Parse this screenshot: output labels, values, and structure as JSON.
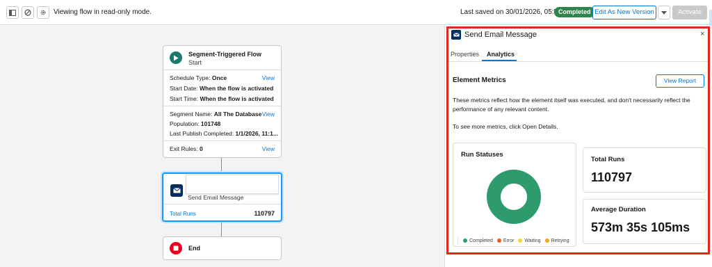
{
  "toolbar": {
    "read_only_message": "Viewing flow in read-only mode.",
    "last_saved": "Last saved on 30/01/2026, 05:54 am",
    "status_badge": "Completed",
    "edit_button": "Edit As New Version",
    "activate_button": "Activate"
  },
  "start_node": {
    "title": "Segment-Triggered Flow",
    "subtitle": "Start",
    "schedule_type_label": "Schedule Type:",
    "schedule_type_value": "Once",
    "start_date_label": "Start Date:",
    "start_date_value": "When the flow is activated",
    "start_time_label": "Start Time:",
    "start_time_value": "When the flow is activated",
    "segment_name_label": "Segment Name:",
    "segment_name_value": "All The Database",
    "population_label": "Population:",
    "population_value": "101748",
    "last_publish_label": "Last Publish Completed:",
    "last_publish_value": "1/1/2026, 11:1...",
    "exit_rules_label": "Exit Rules:",
    "exit_rules_value": "0",
    "view_label": "View"
  },
  "email_node": {
    "subtitle": "Send Email Message",
    "total_runs_label": "Total Runs",
    "total_runs_value": "110797"
  },
  "end_node": {
    "label": "End"
  },
  "panel": {
    "title": "Send Email Message",
    "close": "×",
    "tabs": [
      "Properties",
      "Analytics"
    ],
    "active_tab": "Analytics",
    "element_metrics_title": "Element Metrics",
    "view_report_button": "View Report",
    "description": "These metrics reflect how the element itself was executed, and don't necessarily reflect the performance of any relevant content.",
    "more_metrics": "To see more metrics, click Open Details.",
    "run_statuses_title": "Run Statuses",
    "total_runs_title": "Total Runs",
    "total_runs_value": "110797",
    "average_duration_title": "Average Duration",
    "average_duration_value": "573m 35s 105ms",
    "legend": [
      {
        "label": "Completed",
        "color": "#2e9b6e"
      },
      {
        "label": "Error",
        "color": "#e2621c"
      },
      {
        "label": "Waiting",
        "color": "#f2d63c"
      },
      {
        "label": "Retrying",
        "color": "#f0a31b"
      }
    ]
  },
  "colors": {
    "accent": "#0176d3",
    "completed": "#2e844a",
    "highlight_frame": "#e3281e"
  }
}
